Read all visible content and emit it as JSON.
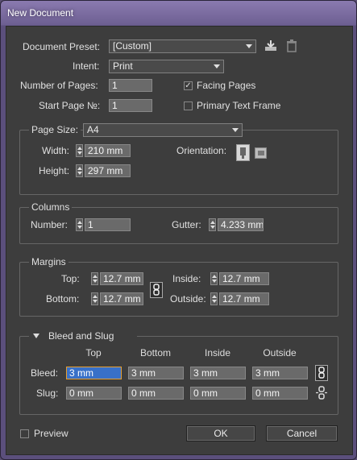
{
  "window": {
    "title": "New Document"
  },
  "preset": {
    "label": "Document Preset:",
    "value": "[Custom]"
  },
  "intent": {
    "label": "Intent:",
    "value": "Print"
  },
  "pages": {
    "number_label": "Number of Pages:",
    "number_value": "1",
    "start_label": "Start Page №:",
    "start_value": "1",
    "facing_label": "Facing Pages",
    "facing_checked": true,
    "primary_label": "Primary Text Frame",
    "primary_checked": false
  },
  "page_size": {
    "label": "Page Size:",
    "value": "A4",
    "width_label": "Width:",
    "width_value": "210 mm",
    "height_label": "Height:",
    "height_value": "297 mm",
    "orientation_label": "Orientation:"
  },
  "columns": {
    "title": "Columns",
    "number_label": "Number:",
    "number_value": "1",
    "gutter_label": "Gutter:",
    "gutter_value": "4.233 mm"
  },
  "margins": {
    "title": "Margins",
    "top_label": "Top:",
    "top_value": "12.7 mm",
    "bottom_label": "Bottom:",
    "bottom_value": "12.7 mm",
    "inside_label": "Inside:",
    "inside_value": "12.7 mm",
    "outside_label": "Outside:",
    "outside_value": "12.7 mm"
  },
  "bleed_slug": {
    "title": "Bleed and Slug",
    "headers": [
      "Top",
      "Bottom",
      "Inside",
      "Outside"
    ],
    "bleed_label": "Bleed:",
    "bleed_values": [
      "3 mm",
      "3 mm",
      "3 mm",
      "3 mm"
    ],
    "slug_label": "Slug:",
    "slug_values": [
      "0 mm",
      "0 mm",
      "0 mm",
      "0 mm"
    ]
  },
  "footer": {
    "preview_label": "Preview",
    "ok_label": "OK",
    "cancel_label": "Cancel"
  },
  "colors": {
    "panel": "#3d3d3d",
    "titlebar": "#6d5f92",
    "active_field": "#3870c8"
  }
}
